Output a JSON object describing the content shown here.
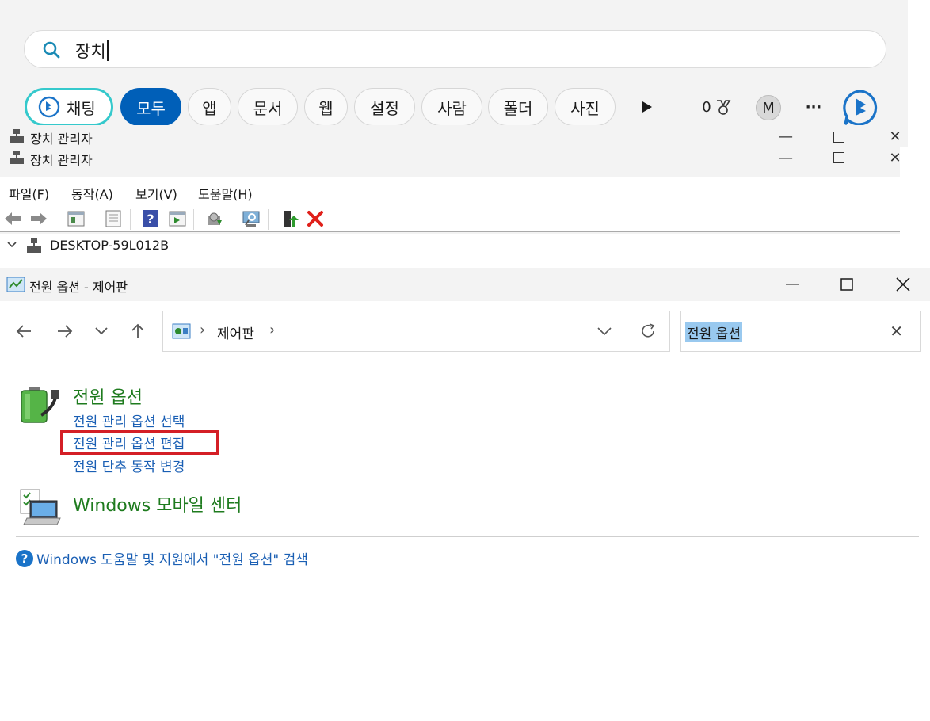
{
  "search": {
    "query": "장치",
    "tabs": [
      {
        "label": "채팅"
      },
      {
        "label": "모두"
      },
      {
        "label": "앱"
      },
      {
        "label": "문서"
      },
      {
        "label": "웹"
      },
      {
        "label": "설정"
      },
      {
        "label": "사람"
      },
      {
        "label": "폴더"
      },
      {
        "label": "사진"
      }
    ],
    "points": "0",
    "avatar_initial": "M",
    "more": "···"
  },
  "device_manager": {
    "title": "장치 관리자",
    "menu": [
      "파일(F)",
      "동작(A)",
      "보기(V)",
      "도움말(H)"
    ],
    "tree_root": "DESKTOP-59L012B"
  },
  "control_panel": {
    "title": "전원 옵션 - 제어판",
    "breadcrumb": "제어판",
    "search_value": "전원 옵션",
    "categories": [
      {
        "title": "전원 옵션",
        "links": [
          "전원 관리 옵션 선택",
          "전원 관리 옵션 편집",
          "전원 단추 동작 변경"
        ]
      },
      {
        "title": "Windows 모바일 센터",
        "links": []
      }
    ],
    "help_link": "Windows 도움말 및 지원에서 \"전원 옵션\" 검색"
  },
  "colors": {
    "accent": "#005fb8",
    "category_green": "#1e7b1e",
    "link_blue": "#1a5fb4",
    "highlight_red": "#d41f26"
  }
}
